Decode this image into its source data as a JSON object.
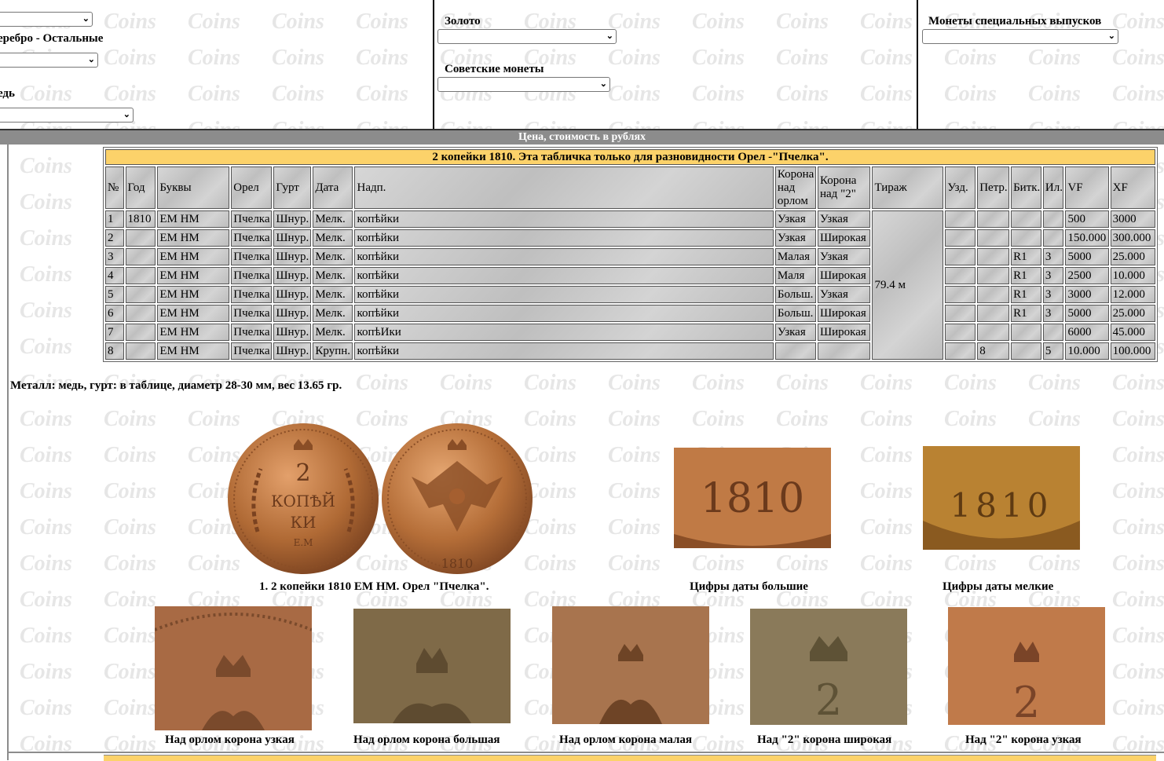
{
  "selectors": {
    "left_label_top": "Серебро - Остальные",
    "left_label_copper": "Медь",
    "gold_label": "Золото",
    "soviet_label": "Советские монеты",
    "special_label": "Монеты специальных выпусков"
  },
  "price_bar": "Цена, стоимость в рублях",
  "table": {
    "title": "2 копейки 1810. Эта табличка только для разновидности Орел -\"Пчелка\".",
    "headers": [
      "№",
      "Год",
      "Буквы",
      "Орел",
      "Гурт",
      "Дата",
      "Надп.",
      "Корона над орлом",
      "Корона над \"2\"",
      "Тираж",
      "Узд.",
      "Петр.",
      "Битк.",
      "Ил.",
      "VF",
      "XF"
    ],
    "tirazh": "79.4 м",
    "rows": [
      {
        "n": "1",
        "year": "1810",
        "letters": "ЕМ НМ",
        "eagle": "Пчелка",
        "edge": "Шнур.",
        "date": "Мелк.",
        "legend": "копѣйки",
        "crown_eagle": "Узкая",
        "crown_2": "Узкая",
        "uzd": "",
        "petr": "",
        "bitk": "",
        "il": "",
        "vf": "500",
        "xf": "3000"
      },
      {
        "n": "2",
        "year": "",
        "letters": "ЕМ НМ",
        "eagle": "Пчелка",
        "edge": "Шнур.",
        "date": "Мелк.",
        "legend": "копѣйки",
        "crown_eagle": "Узкая",
        "crown_2": "Широкая",
        "uzd": "",
        "petr": "",
        "bitk": "",
        "il": "",
        "vf": "150.000",
        "xf": "300.000"
      },
      {
        "n": "3",
        "year": "",
        "letters": "ЕМ НМ",
        "eagle": "Пчелка",
        "edge": "Шнур.",
        "date": "Мелк.",
        "legend": "копѣйки",
        "crown_eagle": "Малая",
        "crown_2": "Узкая",
        "uzd": "",
        "petr": "",
        "bitk": "R1",
        "il": "3",
        "vf": "5000",
        "xf": "25.000"
      },
      {
        "n": "4",
        "year": "",
        "letters": "ЕМ НМ",
        "eagle": "Пчелка",
        "edge": "Шнур.",
        "date": "Мелк.",
        "legend": "копѣйки",
        "crown_eagle": "Маля",
        "crown_2": "Широкая",
        "uzd": "",
        "petr": "",
        "bitk": "R1",
        "il": "3",
        "vf": "2500",
        "xf": "10.000"
      },
      {
        "n": "5",
        "year": "",
        "letters": "ЕМ НМ",
        "eagle": "Пчелка",
        "edge": "Шнур.",
        "date": "Мелк.",
        "legend": "копѣйки",
        "crown_eagle": "Больш.",
        "crown_2": "Узкая",
        "uzd": "",
        "petr": "",
        "bitk": "R1",
        "il": "3",
        "vf": "3000",
        "xf": "12.000"
      },
      {
        "n": "6",
        "year": "",
        "letters": "ЕМ НМ",
        "eagle": "Пчелка",
        "edge": "Шнур.",
        "date": "Мелк.",
        "legend": "копѣйки",
        "crown_eagle": "Больш.",
        "crown_2": "Широкая",
        "uzd": "",
        "petr": "",
        "bitk": "R1",
        "il": "3",
        "vf": "5000",
        "xf": "25.000"
      },
      {
        "n": "7",
        "year": "",
        "letters": "ЕМ НМ",
        "eagle": "Пчелка",
        "edge": "Шнур.",
        "date": "Мелк.",
        "legend": "копѣИки",
        "crown_eagle": "Узкая",
        "crown_2": "Широкая",
        "uzd": "",
        "petr": "",
        "bitk": "",
        "il": "",
        "vf": "6000",
        "xf": "45.000"
      },
      {
        "n": "8",
        "year": "",
        "letters": "ЕМ НМ",
        "eagle": "Пчелка",
        "edge": "Шнур.",
        "date": "Крупн.",
        "legend": "копѣйки",
        "crown_eagle": "",
        "crown_2": "",
        "uzd": "",
        "petr": "8",
        "bitk": "",
        "il": "5",
        "vf": "10.000",
        "xf": "100.000"
      }
    ]
  },
  "metal_note": "Металл: медь, гурт: в таблице, диаметр 28-30 мм, вес 13.65 гр.",
  "captions": {
    "main_coin": "1. 2 копейки 1810 ЕМ НМ. Орел \"Пчелка\".",
    "date_big": "Цифры даты большие",
    "date_small": "Цифры даты мелкие",
    "crown_narrow": "Над орлом корона узкая",
    "crown_big": "Над орлом корона большая",
    "crown_small": "Над орлом корона малая",
    "crown2_wide": "Над \"2\" корона широкая",
    "crown2_narrow": "Над \"2\" корона узкая"
  },
  "coin_text": {
    "reverse_value": "2",
    "reverse_word1": "КОПѢЙ",
    "reverse_word2": "КИ",
    "mint": "Е.М",
    "year": "1810"
  },
  "colors": {
    "title_yellow": "#fcd26a",
    "price_bar": "#8c8c8c",
    "copper": "#b06a35"
  }
}
